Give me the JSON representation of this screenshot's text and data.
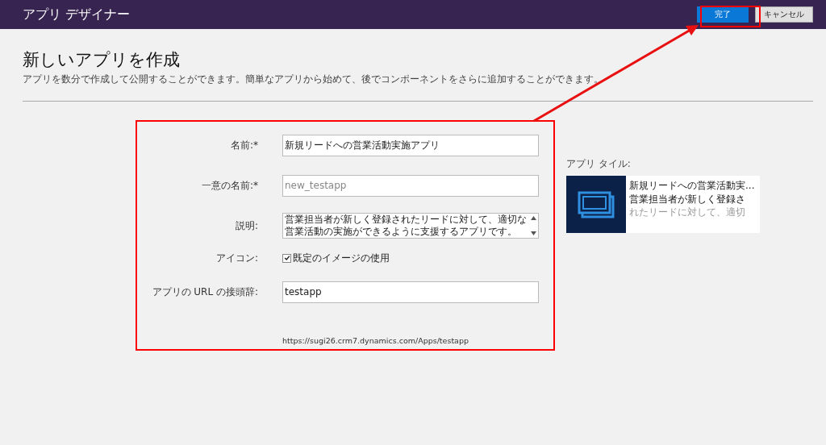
{
  "header": {
    "title": "アプリ デザイナー",
    "buttons": [
      {
        "label": "完了",
        "kind": "primary"
      },
      {
        "label": "キャンセル",
        "kind": "secondary"
      }
    ]
  },
  "page": {
    "title": "新しいアプリを作成",
    "subtitle": "アプリを数分で作成して公開することができます。簡単なアプリから始めて、後でコンポーネントをさらに追加することができます。"
  },
  "form": {
    "fields": [
      {
        "kind": "input",
        "label": "名前:*",
        "value": "新規リードへの営業活動実施アプリ"
      },
      {
        "kind": "input",
        "label": "一意の名前:*",
        "placeholder": "new_testapp"
      },
      {
        "kind": "textarea",
        "label": "説明:",
        "lines": [
          "営業担当者が新しく登録されたリードに対して、適切な",
          "営業活動の実施ができるように支援するアプリです。"
        ]
      },
      {
        "kind": "checkbox",
        "label": "アイコン:",
        "text": "既定のイメージの使用",
        "checked": true
      },
      {
        "kind": "input",
        "label": "アプリの URL の接頭辞:",
        "value": "testapp"
      }
    ],
    "url": "https://sugi26.crm7.dynamics.com/Apps/testapp"
  },
  "tile": {
    "label": "アプリ タイル:",
    "title": "新規リードへの営業活動実...",
    "description_lines": [
      "営業担当者が新しく登録さ",
      "れたリードに対して、適切"
    ]
  }
}
